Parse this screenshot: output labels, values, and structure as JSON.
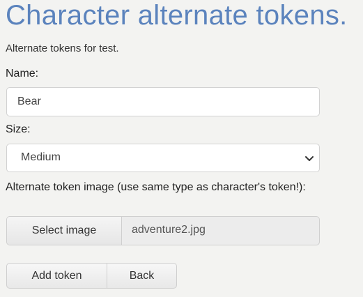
{
  "page": {
    "title": "Character alternate tokens.",
    "subtitle": "Alternate tokens for test."
  },
  "form": {
    "name_label": "Name:",
    "name_value": "Bear",
    "size_label": "Size:",
    "size_value": "Medium",
    "size_icon": "chevron-down-icon",
    "image_label": "Alternate token image (use same type as character's token!):",
    "select_image_label": "Select image",
    "file_name": "adventure2.jpg"
  },
  "actions": {
    "add_label": "Add token",
    "back_label": "Back"
  },
  "colors": {
    "title": "#5b83bd",
    "background": "#f3f3f1"
  }
}
